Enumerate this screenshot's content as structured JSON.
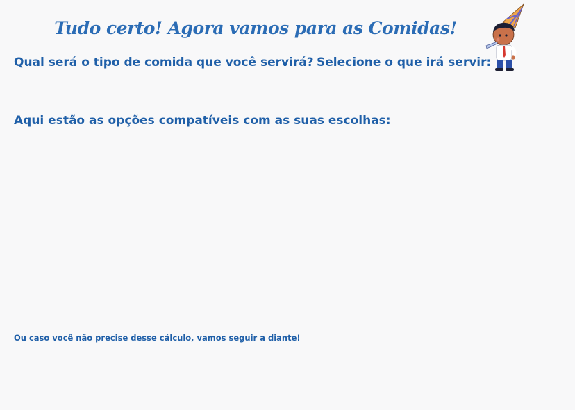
{
  "header": {
    "title": "Tudo certo! Agora vamos para as Comidas!",
    "mascot_icon": "party-boy-with-horn-icon"
  },
  "food_type": {
    "question": "Qual será o tipo de comida que você servirá?"
  },
  "serve_select": {
    "label": "Selecione o que irá servir:"
  },
  "options": {
    "heading": "Aqui estão as opções compatíveis com as suas escolhas:"
  },
  "footer": {
    "skip_text": "Ou caso você não precise desse cálculo, vamos seguir a diante!"
  },
  "colors": {
    "background": "#f8f8f9",
    "text": "#1f5fa8",
    "title": "#2b6cb5"
  }
}
